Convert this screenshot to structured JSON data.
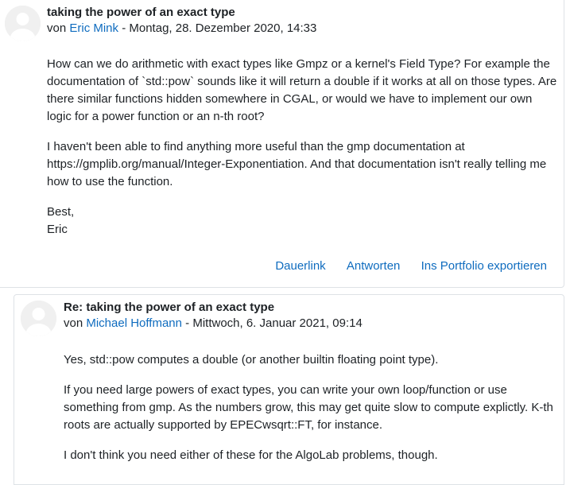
{
  "posts": [
    {
      "subject": "taking the power of an exact type",
      "by_prefix": "von",
      "author": "Eric Mink",
      "date_sep": " - ",
      "date": "Montag, 28. Dezember 2020, 14:33",
      "paragraphs": [
        "How can we do arithmetic with exact types like Gmpz or a kernel's Field Type? For example the documentation of `std::pow` sounds like it will return a double if it works at all on those types. Are there similar functions hidden somewhere in CGAL, or would we have to implement our own logic for a power function or an n-th root?",
        "I haven't been able to find anything more useful than the gmp documentation at https://gmplib.org/manual/Integer-Exponentiation. And that documentation isn't really telling me how to use the function."
      ],
      "closing": [
        "Best,",
        "Eric"
      ],
      "commands": [
        "Dauerlink",
        "Antworten",
        "Ins Portfolio exportieren"
      ]
    },
    {
      "subject": "Re: taking the power of an exact type",
      "by_prefix": "von",
      "author": "Michael Hoffmann",
      "date_sep": " - ",
      "date": "Mittwoch, 6. Januar 2021, 09:14",
      "paragraphs": [
        "Yes, std::pow computes a double (or another builtin floating point type).",
        "If you need large powers of exact types, you can write your own loop/function or use something from gmp. As the numbers grow, this may get quite slow to compute explictly. K-th roots are actually supported by EPECwsqrt::FT, for instance.",
        "I don't think you need either of these for the AlgoLab problems, though."
      ]
    }
  ]
}
